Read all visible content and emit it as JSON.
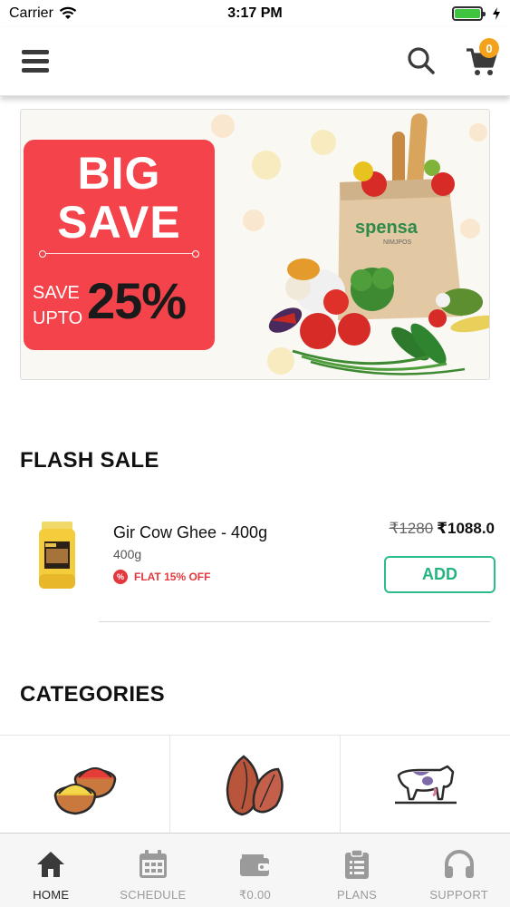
{
  "status_bar": {
    "carrier": "Carrier",
    "time": "3:17 PM"
  },
  "header": {
    "cart_count": "0"
  },
  "banner": {
    "headline_1": "BIG",
    "headline_2": "SAVE",
    "save_text_1": "SAVE",
    "save_text_2": "UPTO",
    "percent": "25%",
    "brand": "spensa",
    "brand_sub": "NIMJPOS"
  },
  "flash_sale": {
    "title": "FLASH SALE",
    "product": {
      "name": "Gir Cow Ghee - 400g",
      "weight": "400g",
      "offer": "FLAT 15% OFF",
      "offer_icon": "%",
      "price_old": "₹1280",
      "price_new": "₹1088.0",
      "add_label": "ADD"
    }
  },
  "categories": {
    "title": "CATEGORIES",
    "items": [
      {
        "icon": "spice-bowls-icon"
      },
      {
        "icon": "almonds-icon"
      },
      {
        "icon": "cow-icon"
      }
    ]
  },
  "bottom_nav": {
    "items": [
      {
        "label": "HOME",
        "icon": "home-icon",
        "active": true
      },
      {
        "label": "SCHEDULE",
        "icon": "calendar-icon",
        "active": false
      },
      {
        "label": "₹0.00",
        "icon": "wallet-icon",
        "active": false
      },
      {
        "label": "PLANS",
        "icon": "clipboard-icon",
        "active": false
      },
      {
        "label": "SUPPORT",
        "icon": "headphones-icon",
        "active": false
      }
    ]
  },
  "colors": {
    "accent_green": "#23b47f",
    "promo_red": "#f4434a",
    "badge_orange": "#f4a11c",
    "offer_red": "#e3383e"
  }
}
